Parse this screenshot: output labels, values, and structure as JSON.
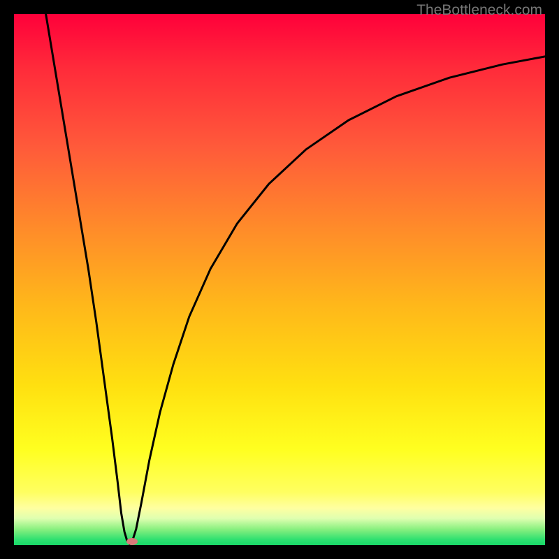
{
  "attribution": "TheBottleneck.com",
  "chart_data": {
    "type": "line",
    "title": "",
    "xlabel": "",
    "ylabel": "",
    "xlim": [
      0,
      100
    ],
    "ylim": [
      0,
      100
    ],
    "curve_points_pct": [
      [
        6.0,
        100.0
      ],
      [
        8.0,
        88.0
      ],
      [
        10.0,
        76.0
      ],
      [
        12.0,
        64.0
      ],
      [
        14.0,
        52.0
      ],
      [
        15.5,
        42.0
      ],
      [
        17.0,
        31.0
      ],
      [
        18.5,
        20.0
      ],
      [
        19.5,
        12.0
      ],
      [
        20.2,
        6.0
      ],
      [
        20.8,
        2.5
      ],
      [
        21.3,
        0.8
      ],
      [
        21.8,
        0.2
      ],
      [
        22.3,
        0.8
      ],
      [
        23.0,
        3.0
      ],
      [
        24.0,
        8.0
      ],
      [
        25.5,
        16.0
      ],
      [
        27.5,
        25.0
      ],
      [
        30.0,
        34.0
      ],
      [
        33.0,
        43.0
      ],
      [
        37.0,
        52.0
      ],
      [
        42.0,
        60.5
      ],
      [
        48.0,
        68.0
      ],
      [
        55.0,
        74.5
      ],
      [
        63.0,
        80.0
      ],
      [
        72.0,
        84.5
      ],
      [
        82.0,
        88.0
      ],
      [
        92.0,
        90.5
      ],
      [
        100.0,
        92.0
      ]
    ],
    "marker_pct": {
      "x": 22.3,
      "y": 0.7
    },
    "colors": {
      "curve": "#000000",
      "marker": "#d97a7a",
      "frame": "#000000"
    }
  }
}
